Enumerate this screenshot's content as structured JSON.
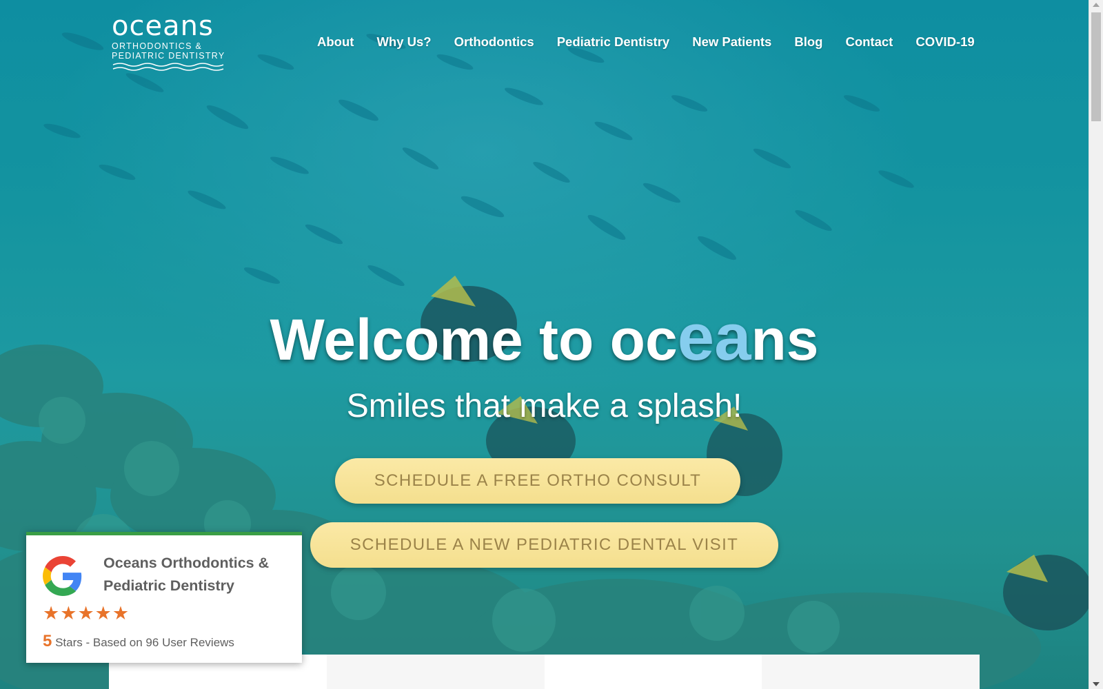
{
  "header": {
    "logo": {
      "word": "oceans",
      "line1": "ORTHODONTICS &",
      "line2": "PEDIATRIC DENTISTRY"
    },
    "nav": [
      {
        "label": "About"
      },
      {
        "label": "Why Us?"
      },
      {
        "label": "Orthodontics"
      },
      {
        "label": "Pediatric Dentistry"
      },
      {
        "label": "New Patients"
      },
      {
        "label": "Blog"
      },
      {
        "label": "Contact"
      },
      {
        "label": "COVID-19"
      }
    ]
  },
  "hero": {
    "welcome_prefix": "Welcome to oc",
    "welcome_highlight": "ea",
    "welcome_suffix": "ns",
    "tagline": "Smiles that make a splash!",
    "cta_ortho": "SCHEDULE A FREE ORTHO CONSULT",
    "cta_pediatric": "SCHEDULE A NEW PEDIATRIC DENTAL VISIT"
  },
  "review": {
    "business_name": "Oceans Orthodontics & Pediatric Dentistry",
    "stars": 5,
    "rating": "5",
    "rating_text": "Stars - Based on 96 User Reviews",
    "icon": "google-g-icon"
  },
  "colors": {
    "nav_text": "#ffffff",
    "highlight": "#86cdee",
    "cta_bg": "#f4df8e",
    "cta_text": "#9b8349",
    "star": "#e8732a",
    "review_border": "#3a9e45"
  }
}
